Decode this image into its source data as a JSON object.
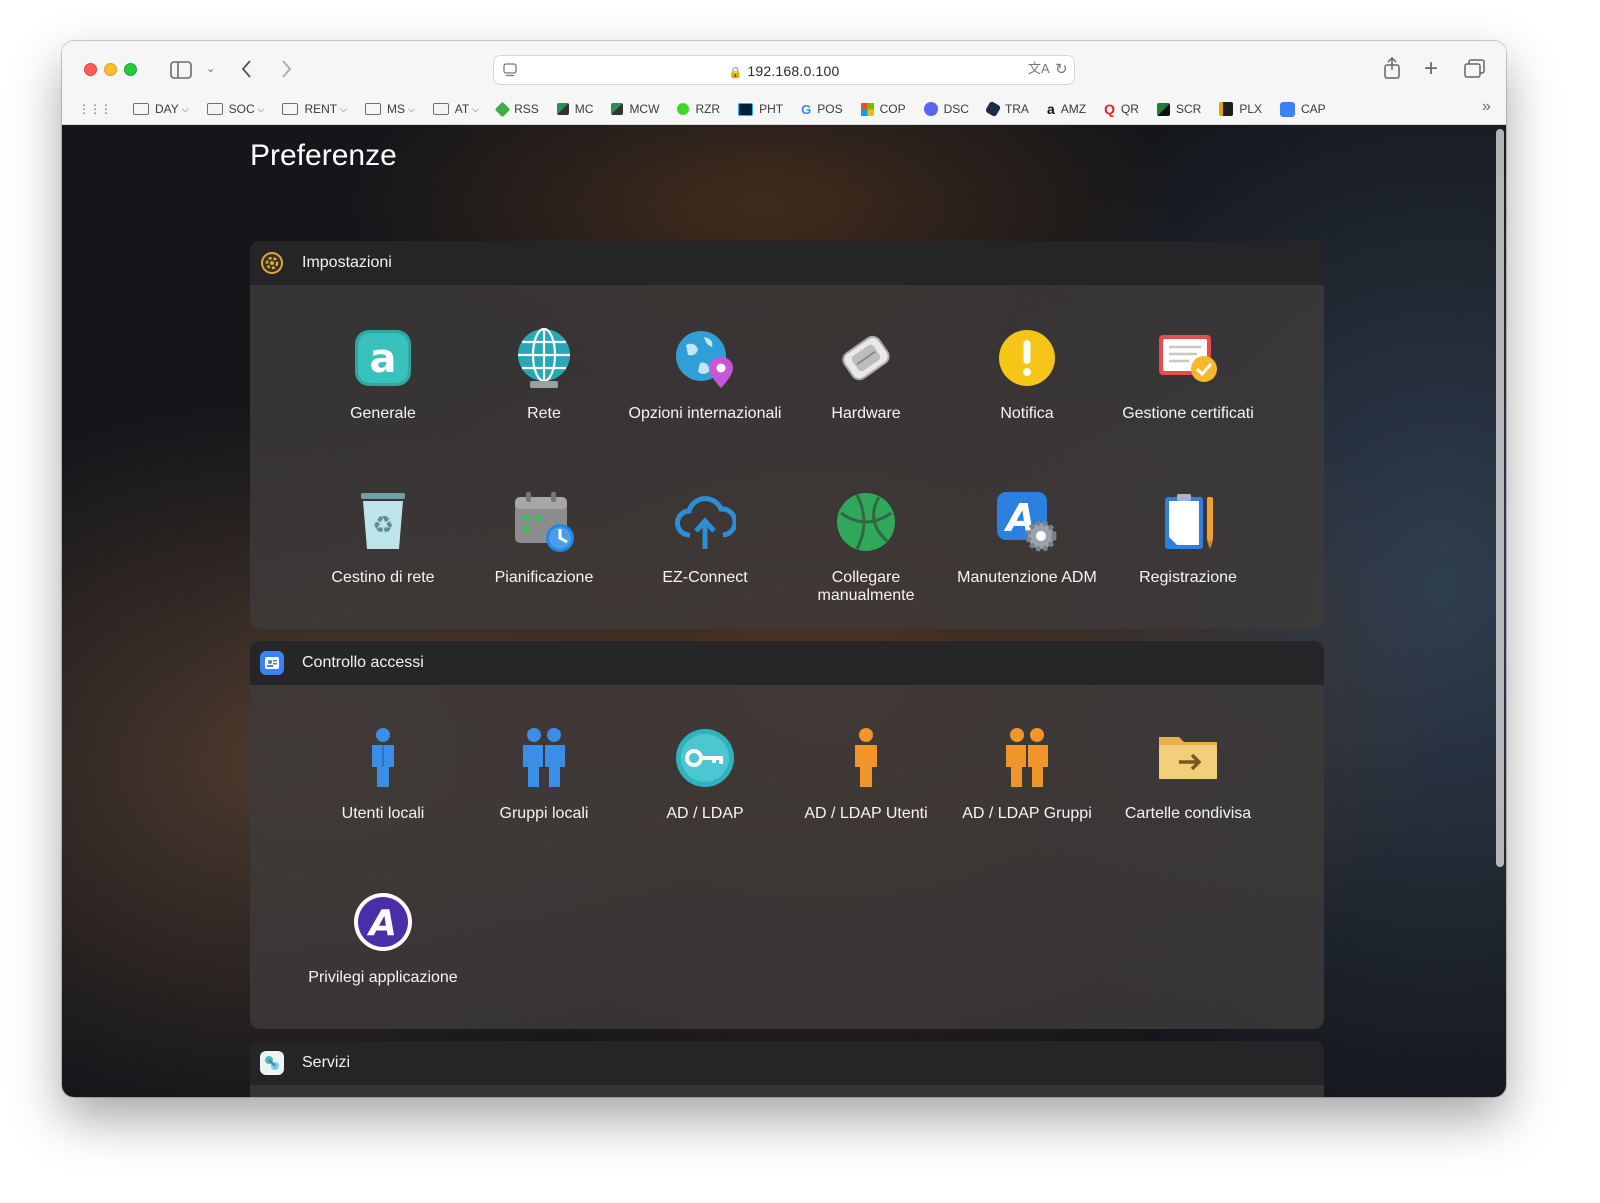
{
  "browser": {
    "url": "192.168.0.100",
    "bookmarks": [
      {
        "label": "DAY",
        "kind": "folder"
      },
      {
        "label": "SOC",
        "kind": "folder"
      },
      {
        "label": "RENT",
        "kind": "folder"
      },
      {
        "label": "MS",
        "kind": "folder"
      },
      {
        "label": "AT",
        "kind": "folder"
      },
      {
        "label": "RSS",
        "kind": "link",
        "color": "#3fae49"
      },
      {
        "label": "MC",
        "kind": "link",
        "color": "#2e8b57"
      },
      {
        "label": "MCW",
        "kind": "link",
        "color": "#2e8b57"
      },
      {
        "label": "RZR",
        "kind": "link",
        "color": "#44d62c"
      },
      {
        "label": "PHT",
        "kind": "link",
        "color": "#001e36"
      },
      {
        "label": "POS",
        "kind": "link",
        "color": "#4285f4"
      },
      {
        "label": "COP",
        "kind": "link",
        "color": "#f25022"
      },
      {
        "label": "DSC",
        "kind": "link",
        "color": "#5865f2"
      },
      {
        "label": "TRA",
        "kind": "link",
        "color": "#1f2a44"
      },
      {
        "label": "AMZ",
        "kind": "link",
        "color": "#111111"
      },
      {
        "label": "QR",
        "kind": "link",
        "color": "#e02424"
      },
      {
        "label": "SCR",
        "kind": "link",
        "color": "#1a7f37"
      },
      {
        "label": "PLX",
        "kind": "link",
        "color": "#e5a00d"
      },
      {
        "label": "CAP",
        "kind": "link",
        "color": "#3b82f6"
      }
    ]
  },
  "page": {
    "title": "Preferenze"
  },
  "sections": [
    {
      "title": "Impostazioni",
      "items": [
        "Generale",
        "Rete",
        "Opzioni internazionali",
        "Hardware",
        "Notifica",
        "Gestione certificati",
        "Cestino di rete",
        "Pianificazione",
        "EZ-Connect",
        "Collegare manualmente",
        "Manutenzione ADM",
        "Registrazione"
      ]
    },
    {
      "title": "Controllo accessi",
      "items": [
        "Utenti locali",
        "Gruppi locali",
        "AD / LDAP",
        "AD / LDAP Utenti",
        "AD / LDAP Gruppi",
        "Cartelle condivisa",
        "Privilegi applicazione"
      ]
    },
    {
      "title": "Servizi",
      "items": []
    }
  ]
}
